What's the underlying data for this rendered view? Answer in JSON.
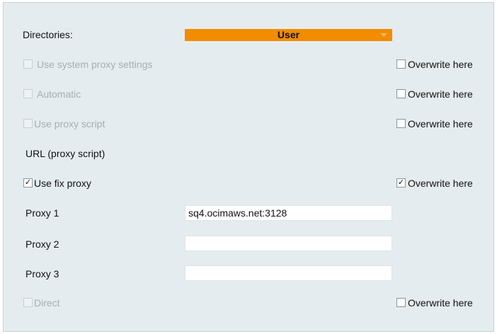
{
  "directories": {
    "label": "Directories:",
    "selected": "User"
  },
  "options": [
    {
      "label": "Use system proxy settings",
      "checked": false,
      "enabled": false,
      "overwrite_label": "Overwrite here",
      "overwrite_checked": false
    },
    {
      "label": "Automatic",
      "checked": false,
      "enabled": false,
      "overwrite_label": "Overwrite here",
      "overwrite_checked": false
    },
    {
      "label": "Use proxy script",
      "checked": false,
      "enabled": false,
      "overwrite_label": "Overwrite here",
      "overwrite_checked": false
    }
  ],
  "url_proxy_script": {
    "label": "URL (proxy script)"
  },
  "fix_proxy": {
    "label": "Use fix proxy",
    "checked": true,
    "overwrite_label": "Overwrite here",
    "overwrite_checked": true
  },
  "proxies": [
    {
      "label": "Proxy 1",
      "value": "sq4.ocimaws.net:3128"
    },
    {
      "label": "Proxy 2",
      "value": ""
    },
    {
      "label": "Proxy 3",
      "value": ""
    }
  ],
  "direct": {
    "label": "Direct",
    "checked": false,
    "enabled": false,
    "overwrite_label": "Overwrite here",
    "overwrite_checked": false
  },
  "colors": {
    "panel_background": "#e5ecef",
    "dropdown_accent": "#f28c00",
    "disabled_text": "#a6aeb2"
  }
}
